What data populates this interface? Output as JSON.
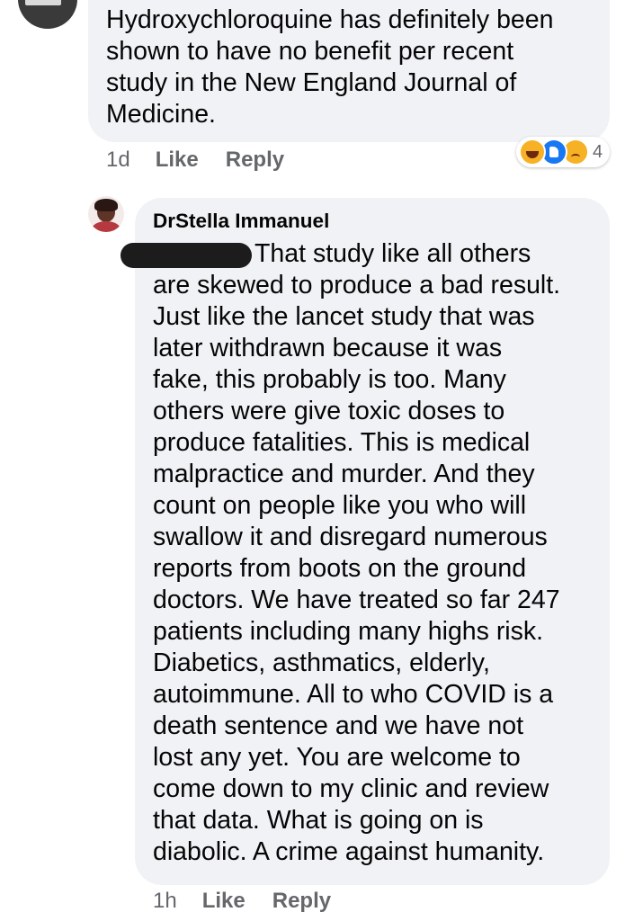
{
  "comment_1": {
    "text": "Hydroxychloroquine has definitely been\nshown to have no benefit per recent\nstudy in the New England Journal of\nMedicine.",
    "time": "1d",
    "like_label": "Like",
    "reply_label": "Reply",
    "reactions": {
      "icons": [
        "haha-icon",
        "like-icon",
        "sad-icon"
      ],
      "count": "4"
    }
  },
  "comment_2": {
    "author": "DrStella Immanuel",
    "text": "That study like all others\nare skewed to produce a bad result.\nJust like the lancet study that was\nlater withdrawn because it was\nfake, this probably is too. Many\nothers were give toxic doses to\nproduce fatalities. This is medical\nmalpractice and murder. And they\ncount on people like you who will\nswallow it and disregard numerous\nreports from boots on the ground\ndoctors. We have treated so far 247\npatients including many highs risk.\nDiabetics, asthmatics, elderly,\nautoimmune. All to who COVID is a\ndeath sentence and we have not\nlost any yet. You are welcome to\ncome down to my clinic and review\nthat data. What is going on is\ndiabolic. A crime against humanity.",
    "time": "1h",
    "like_label": "Like",
    "reply_label": "Reply"
  },
  "colors": {
    "bubble": "#f0f2f5",
    "meta_text": "#65676b",
    "like_blue": "#1877f2",
    "emoji_yellow": "#f7b125"
  }
}
